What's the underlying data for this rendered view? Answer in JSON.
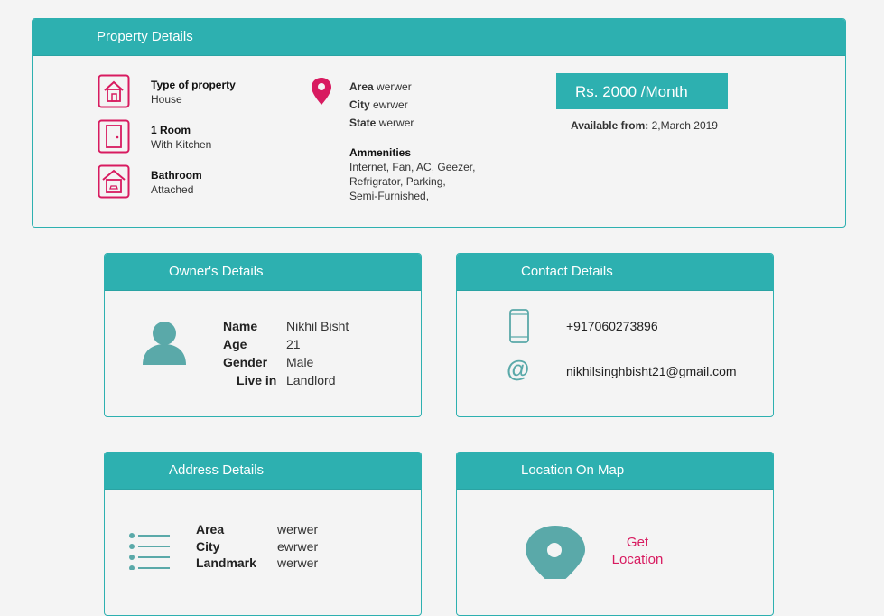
{
  "colors": {
    "teal": "#2db0b0",
    "accent": "#d81b60"
  },
  "property": {
    "title": "Property Details",
    "type_label": "Type of property",
    "type_value": "House",
    "room_label": "1 Room",
    "room_value": "With Kitchen",
    "bath_label": "Bathroom",
    "bath_value": "Attached",
    "area_label": "Area",
    "area_value": "werwer",
    "city_label": "City",
    "city_value": "ewrwer",
    "state_label": "State",
    "state_value": "werwer",
    "amenities_label": "Ammenities",
    "amenities_line1": "Internet, Fan, AC, Geezer,",
    "amenities_line2": "Refrigrator, Parking,",
    "amenities_line3": "Semi-Furnished,",
    "price": "Rs. 2000 /Month",
    "available_label": "Available from:",
    "available_value": "2,March 2019"
  },
  "owner": {
    "title": "Owner's Details",
    "name_label": "Name",
    "name_value": "Nikhil Bisht",
    "age_label": "Age",
    "age_value": "21",
    "gender_label": "Gender",
    "gender_value": "Male",
    "livein_label": "Live in",
    "livein_value": "Landlord"
  },
  "contact": {
    "title": "Contact Details",
    "phone": "+917060273896",
    "email": "nikhilsinghbisht21@gmail.com"
  },
  "address": {
    "title": "Address Details",
    "area_label": "Area",
    "area_value": "werwer",
    "city_label": "City",
    "city_value": "ewrwer",
    "landmark_label": "Landmark",
    "landmark_value": "werwer"
  },
  "map": {
    "title": "Location On Map",
    "link_line1": "Get",
    "link_line2": "Location"
  }
}
